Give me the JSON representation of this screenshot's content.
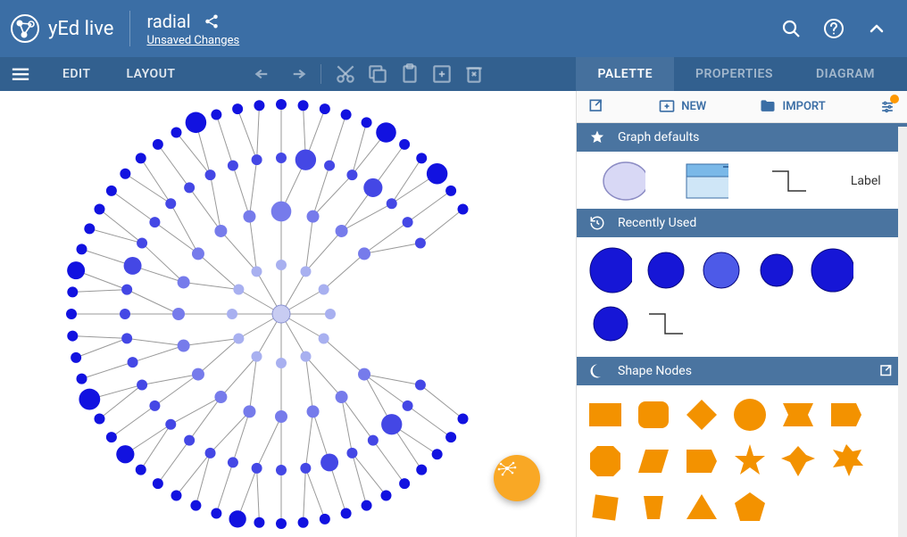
{
  "app": {
    "name": "yEd live"
  },
  "doc": {
    "title": "radial",
    "unsaved": "Unsaved Changes"
  },
  "menus": {
    "edit": "EDIT",
    "layout": "LAYOUT"
  },
  "tabs": {
    "palette": "PALETTE",
    "properties": "PROPERTIES",
    "diagram": "DIAGRAM"
  },
  "sidebar": {
    "new": "NEW",
    "import": "IMPORT",
    "sections": {
      "defaults": "Graph defaults",
      "recent": "Recently Used",
      "shapes": "Shape Nodes"
    },
    "defaults_label": "Label"
  },
  "colors": {
    "primary": "#3b6ea5",
    "toolbar": "#32608f",
    "section": "#4a74a0",
    "accent": "#f9a825",
    "node_blue": "#1616d6",
    "node_light": "#6a78e0",
    "shape_orange": "#f39200"
  }
}
